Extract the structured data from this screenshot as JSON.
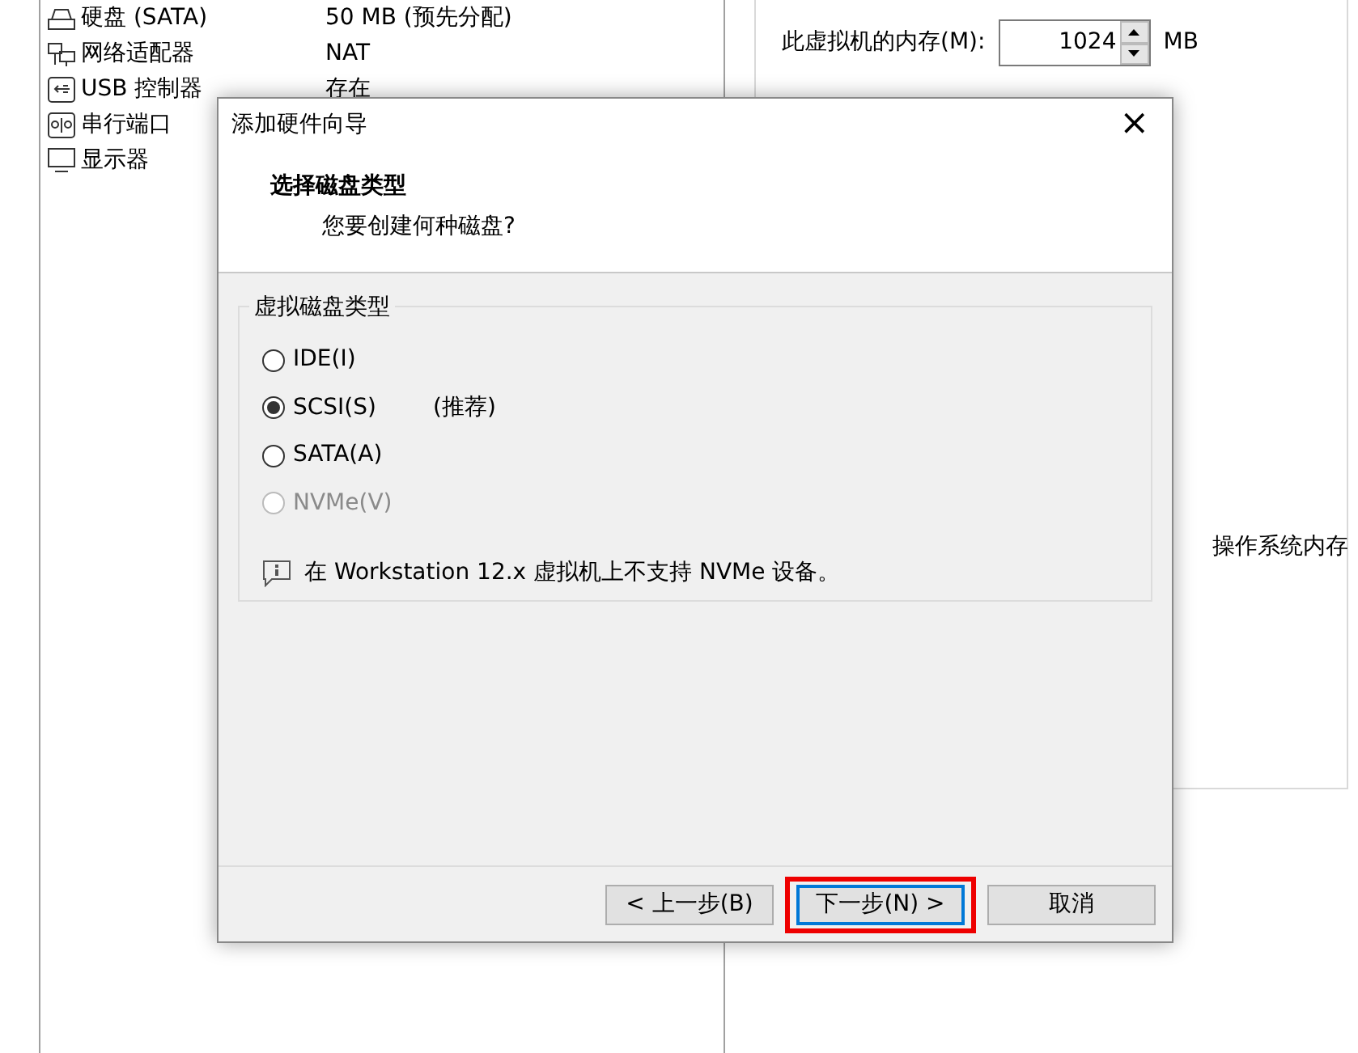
{
  "devices": [
    {
      "kind": "disk",
      "name": "硬盘 (SATA)",
      "summary": "50 MB (预先分配)"
    },
    {
      "kind": "network",
      "name": "网络适配器",
      "summary": "NAT"
    },
    {
      "kind": "usb",
      "name": "USB 控制器",
      "summary": "存在"
    },
    {
      "kind": "serial",
      "name": "串行端口"
    },
    {
      "kind": "display",
      "name": "显示器"
    }
  ],
  "memory": {
    "label": "此虚拟机的内存(M):",
    "value": "1024",
    "unit": "MB",
    "note": "操作系统内存"
  },
  "dialog": {
    "title": "添加硬件向导",
    "close": "×",
    "heading": "选择磁盘类型",
    "subheading": "您要创建何种磁盘?",
    "group": "虚拟磁盘类型",
    "options": [
      {
        "label": "IDE(I)",
        "selected": false,
        "disabled": false
      },
      {
        "label": "SCSI(S)",
        "hint": "(推荐)",
        "selected": true,
        "disabled": false
      },
      {
        "label": "SATA(A)",
        "selected": false,
        "disabled": false
      },
      {
        "label": "NVMe(V)",
        "selected": false,
        "disabled": true
      }
    ],
    "info": "在 Workstation 12.x 虚拟机上不支持 NVMe 设备。",
    "buttons": [
      {
        "label": "< 上一步(B)",
        "focused": false,
        "highlighted": false
      },
      {
        "label": "下一步(N) >",
        "focused": true,
        "highlighted": true
      },
      {
        "label": "取消",
        "focused": false,
        "highlighted": false
      }
    ]
  }
}
